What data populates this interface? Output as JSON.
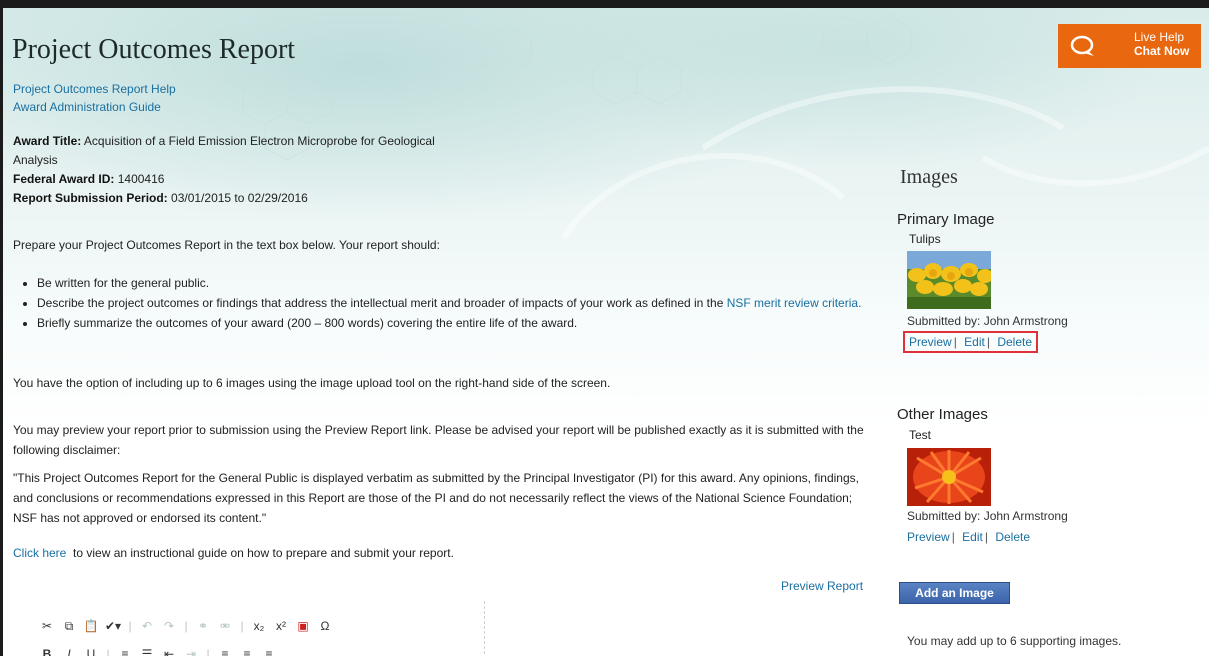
{
  "page": {
    "title": "Project Outcomes Report",
    "help_links": [
      "Project Outcomes Report Help",
      "Award Administration Guide"
    ]
  },
  "award": {
    "title_label": "Award Title:",
    "title_value": "Acquisition of a Field Emission Electron Microprobe for Geological Analysis",
    "id_label": "Federal Award ID:",
    "id_value": "1400416",
    "period_label": "Report Submission Period:",
    "period_value": "03/01/2015 to 02/29/2016"
  },
  "instructions": {
    "intro": "Prepare your Project Outcomes Report in the text box below.  Your report should:",
    "bullet1": "Be written for the general public.",
    "bullet2_pre": "Describe the project outcomes or findings that address the intellectual merit and broader of impacts of your work as defined in the",
    "bullet2_link": "NSF merit review criteria.",
    "bullet3": "Briefly summarize the outcomes of your award (200 – 800 words) covering the entire life of the award.",
    "option": "You have the option of including up to 6 images using the image upload tool on the right-hand side of the screen.",
    "preview": "You may preview your report prior to submission using the Preview Report link.  Please be advised your report will be published exactly as it is submitted with the following disclaimer:",
    "disclaimer": "\"This Project Outcomes Report for the General Public is displayed verbatim as submitted by the Principal Investigator (PI) for this award. Any opinions, findings, and conclusions or recommendations expressed in this Report are those of the PI and do not necessarily reflect the views of the National Science Foundation; NSF has not approved or endorsed its content.\"",
    "click_link": "Click here",
    "click_rest": "to view an instructional guide on how to prepare and submit your report.",
    "preview_report": "Preview Report"
  },
  "live_help": {
    "line1": "Live Help",
    "line2": "Chat Now"
  },
  "images": {
    "heading": "Images",
    "primary": {
      "section": "Primary Image",
      "name": "Tulips",
      "submitted": "Submitted by: John Armstrong",
      "actions": [
        "Preview",
        "Edit",
        "Delete"
      ]
    },
    "other": {
      "section": "Other Images",
      "name": "Test",
      "submitted": "Submitted by: John Armstrong",
      "actions": [
        "Preview",
        "Edit",
        "Delete"
      ]
    },
    "add_button": "Add an Image",
    "note": "You may add up to 6 supporting images."
  },
  "editor_toolbar": {
    "row1": [
      "cut-icon",
      "copy-icon",
      "paste-icon",
      "spellcheck-icon",
      "undo-icon",
      "redo-icon",
      "link-icon",
      "unlink-icon",
      "subscript-icon",
      "superscript-icon",
      "image-icon",
      "special-char-icon"
    ],
    "row2": [
      "bold-icon",
      "italic-icon",
      "underline-icon",
      "numbered-list-icon",
      "bulleted-list-icon",
      "outdent-icon",
      "indent-icon",
      "align-left-icon",
      "align-center-icon",
      "align-right-icon"
    ]
  },
  "colors": {
    "accent_orange": "#e8670f",
    "link_blue": "#1a6fa0",
    "button_blue": "#3b64aa",
    "highlight_red": "#e0313a"
  }
}
